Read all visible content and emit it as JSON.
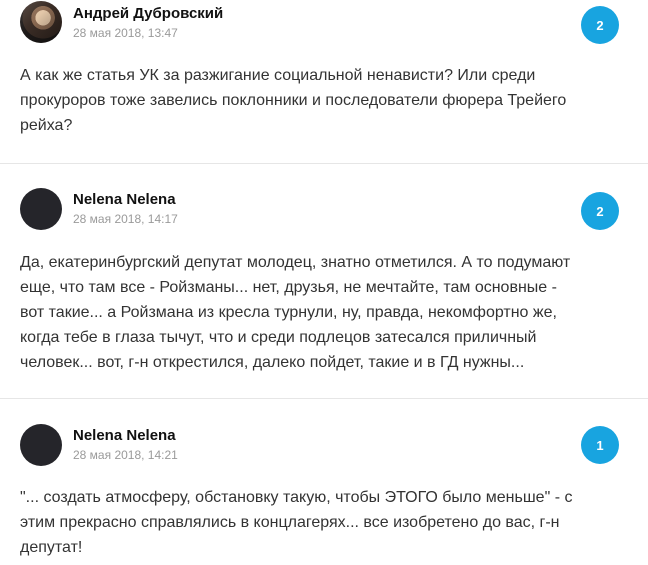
{
  "comments": [
    {
      "author": "Андрей Дубровский",
      "date": "28 мая 2018, 13:47",
      "replies": "2",
      "avatar_icon": "user-photo-avatar",
      "lines": [
        "А как же статья УК за разжигание социальной ненависти? Или среди",
        "прокуроров тоже завелись поклонники и последователи фюрера Трейего",
        "рейха?"
      ]
    },
    {
      "author": "Nelena Nelena",
      "date": "28 мая 2018, 14:17",
      "replies": "2",
      "avatar_icon": "default-dark-avatar",
      "lines": [
        "Да, екатеринбургский депутат молодец, знатно отметился. А то подумают",
        "еще, что там все - Ройзманы... нет, друзья, не мечтайте, там основные -",
        "вот такие... а Ройзмана из кресла турнули, ну, правда, некомфортно же,",
        "когда тебе в глаза тычут, что и среди подлецов затесался приличный",
        "человек... вот, г-н открестился, далеко пойдет, такие и в ГД нужны..."
      ]
    },
    {
      "author": "Nelena Nelena",
      "date": "28 мая 2018, 14:21",
      "replies": "1",
      "avatar_icon": "default-dark-avatar",
      "lines": [
        "\"... создать атмосферу, обстановку такую, чтобы ЭТОГО было меньше\" - с",
        "этим прекрасно справлялись в концлагерях... все изобретено до вас, г-н",
        "депутат!"
      ]
    }
  ],
  "colors": {
    "badge": "#18a4e0",
    "separator": "#e6e6e6",
    "date": "#9a9a9a"
  }
}
